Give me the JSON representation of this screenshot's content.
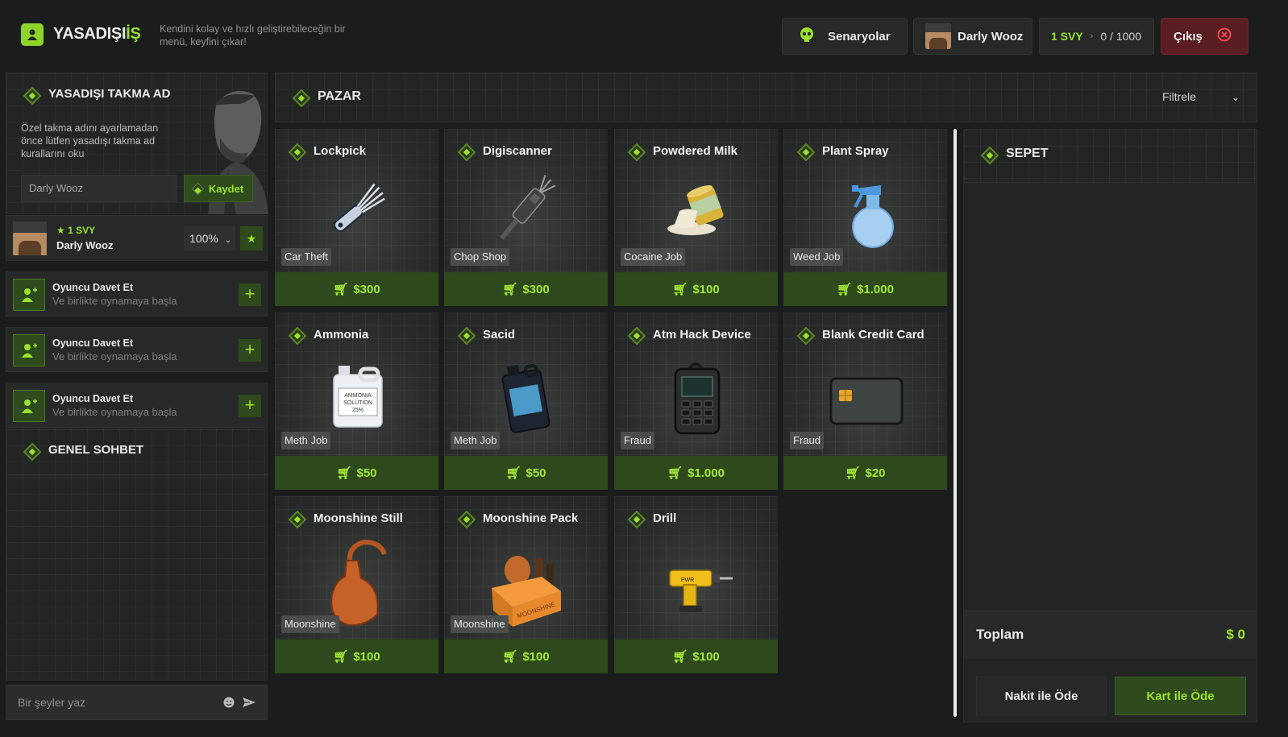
{
  "header": {
    "logo_main": "YASADIŞI",
    "logo_accent": "İŞ",
    "tagline": "Kendini kolay ve hızlı geliştirebileceğin bir menü, keyfini çıkar!",
    "scenarios_label": "Senaryolar",
    "user_name": "Darly Wooz",
    "level_label": "1 SVY",
    "xp_progress": "0 / 1000",
    "exit_label": "Çıkış"
  },
  "nickname": {
    "title": "YASADIŞI TAKMA AD",
    "description": "Özel takma adını ayarlamadan önce lütfen yasadışı takma ad kurallarını oku",
    "input_value": "Darly Wooz",
    "save_label": "Kaydet"
  },
  "profile": {
    "level": "1 SVY",
    "name": "Darly Wooz",
    "zoom": "100%"
  },
  "invites": [
    {
      "title": "Oyuncu Davet Et",
      "subtitle": "Ve birlikte oynamaya başla"
    },
    {
      "title": "Oyuncu Davet Et",
      "subtitle": "Ve birlikte oynamaya başla"
    },
    {
      "title": "Oyuncu Davet Et",
      "subtitle": "Ve birlikte oynamaya başla"
    }
  ],
  "chat": {
    "title": "GENEL SOHBET",
    "placeholder": "Bir şeyler yaz"
  },
  "market": {
    "title": "PAZAR",
    "filter_label": "Filtrele",
    "items": [
      {
        "name": "Lockpick",
        "tag": "Car Theft",
        "price": "$300",
        "icon": "lockpick-icon"
      },
      {
        "name": "Digiscanner",
        "tag": "Chop Shop",
        "price": "$300",
        "icon": "scanner-icon"
      },
      {
        "name": "Powdered Milk",
        "tag": "Cocaine Job",
        "price": "$100",
        "icon": "milk-can-icon"
      },
      {
        "name": "Plant Spray",
        "tag": "Weed Job",
        "price": "$1.000",
        "icon": "spray-bottle-icon"
      },
      {
        "name": "Ammonia",
        "tag": "Meth Job",
        "price": "$50",
        "icon": "jug-icon"
      },
      {
        "name": "Sacid",
        "tag": "Meth Job",
        "price": "$50",
        "icon": "canister-icon"
      },
      {
        "name": "Atm Hack Device",
        "tag": "Fraud",
        "price": "$1.000",
        "icon": "hack-device-icon"
      },
      {
        "name": "Blank Credit Card",
        "tag": "Fraud",
        "price": "$20",
        "icon": "credit-card-icon"
      },
      {
        "name": "Moonshine Still",
        "tag": "Moonshine",
        "price": "$100",
        "icon": "still-icon"
      },
      {
        "name": "Moonshine Pack",
        "tag": "Moonshine",
        "price": "$100",
        "icon": "crate-icon"
      },
      {
        "name": "Drill",
        "tag": "",
        "price": "$100",
        "icon": "drill-icon"
      }
    ]
  },
  "art_labels": {
    "ammonia_1": "AMMONIA",
    "ammonia_2": "SOLUTION",
    "ammonia_3": "25%",
    "crate": "MOONSHINE",
    "drill": "PWR"
  },
  "cart": {
    "title": "SEPET",
    "total_label": "Toplam",
    "total_value": "$ 0",
    "cash_label": "Nakit ile Öde",
    "card_label": "Kart ile Öde"
  },
  "colors": {
    "accent": "#9be22d",
    "accent_dark": "#2f4a1c",
    "exit": "#5a1e22",
    "background": "#1b1d1c"
  }
}
